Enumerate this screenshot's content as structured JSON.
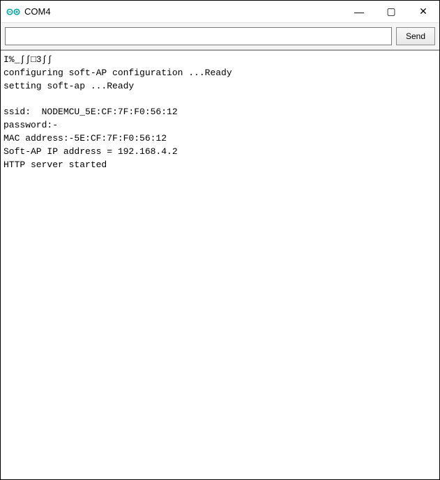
{
  "window": {
    "title": "COM4",
    "icon_name": "arduino-logo-icon",
    "icon_color": "#00a2a2"
  },
  "controls": {
    "minimize_glyph": "—",
    "maximize_glyph": "▢",
    "close_glyph": "✕"
  },
  "input": {
    "value": "",
    "placeholder": "",
    "send_label": "Send"
  },
  "output_text": "I%_∫∫□3∫∫\nconfiguring soft-AP configuration ...Ready\nsetting soft-ap ...Ready\n\nssid:  NODEMCU_5E:CF:7F:F0:56:12\npassword:-\nMAC address:-5E:CF:7F:F0:56:12\nSoft-AP IP address = 192.168.4.2\nHTTP server started"
}
